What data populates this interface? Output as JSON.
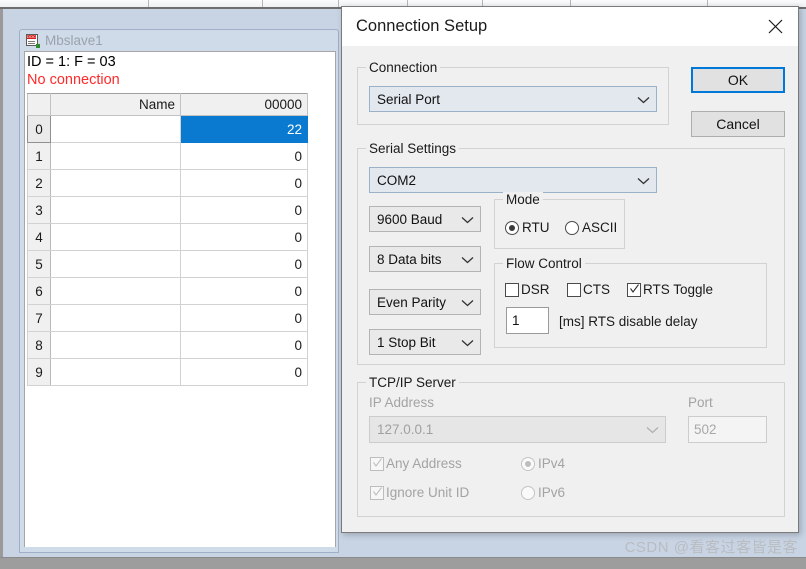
{
  "app": {
    "mdi_child": {
      "title": "Mbslave1",
      "icon": "document-icon",
      "id_line": "ID = 1: F = 03",
      "connection_status": "No connection",
      "connection_status_color": "#ff2a2a"
    },
    "grid": {
      "columns": [
        "",
        "Name",
        "00000"
      ],
      "selected_cell": {
        "row": 0,
        "column": "00000",
        "value": "22"
      },
      "selection_color": "#0a7ad1",
      "rows": [
        {
          "index": "0",
          "name": "",
          "value": "22",
          "selected": true
        },
        {
          "index": "1",
          "name": "",
          "value": "0",
          "selected": false
        },
        {
          "index": "2",
          "name": "",
          "value": "0",
          "selected": false
        },
        {
          "index": "3",
          "name": "",
          "value": "0",
          "selected": false
        },
        {
          "index": "4",
          "name": "",
          "value": "0",
          "selected": false
        },
        {
          "index": "5",
          "name": "",
          "value": "0",
          "selected": false
        },
        {
          "index": "6",
          "name": "",
          "value": "0",
          "selected": false
        },
        {
          "index": "7",
          "name": "",
          "value": "0",
          "selected": false
        },
        {
          "index": "8",
          "name": "",
          "value": "0",
          "selected": false
        },
        {
          "index": "9",
          "name": "",
          "value": "0",
          "selected": false
        }
      ]
    }
  },
  "dialog": {
    "title": "Connection Setup",
    "close_icon": "close-icon",
    "buttons": {
      "ok": "OK",
      "cancel": "Cancel",
      "focus_color": "#0078d7"
    },
    "connection_group": {
      "legend": "Connection",
      "type_value": "Serial Port"
    },
    "serial_settings": {
      "legend": "Serial Settings",
      "port_value": "COM2",
      "baud_value": "9600 Baud",
      "data_bits_value": "8 Data bits",
      "parity_value": "Even Parity",
      "stop_bits_value": "1 Stop Bit",
      "mode": {
        "legend": "Mode",
        "options": [
          {
            "label": "RTU",
            "selected": true
          },
          {
            "label": "ASCII",
            "selected": false
          }
        ]
      },
      "flow_control": {
        "legend": "Flow Control",
        "checkboxes": [
          {
            "label": "DSR",
            "checked": false
          },
          {
            "label": "CTS",
            "checked": false
          },
          {
            "label": "RTS Toggle",
            "checked": true
          }
        ],
        "rts_delay_value": "1",
        "rts_delay_label": "[ms] RTS disable delay"
      }
    },
    "tcpip_server": {
      "legend": "TCP/IP Server",
      "disabled": true,
      "ip_address_label": "IP Address",
      "ip_address_value": "127.0.0.1",
      "port_label": "Port",
      "port_value": "502",
      "any_address": {
        "label": "Any Address",
        "checked": true
      },
      "ignore_unit_id": {
        "label": "Ignore Unit ID",
        "checked": true
      },
      "ip_version": [
        {
          "label": "IPv4",
          "selected": true
        },
        {
          "label": "IPv6",
          "selected": false
        }
      ]
    }
  },
  "watermark": "CSDN @看客过客皆是客"
}
